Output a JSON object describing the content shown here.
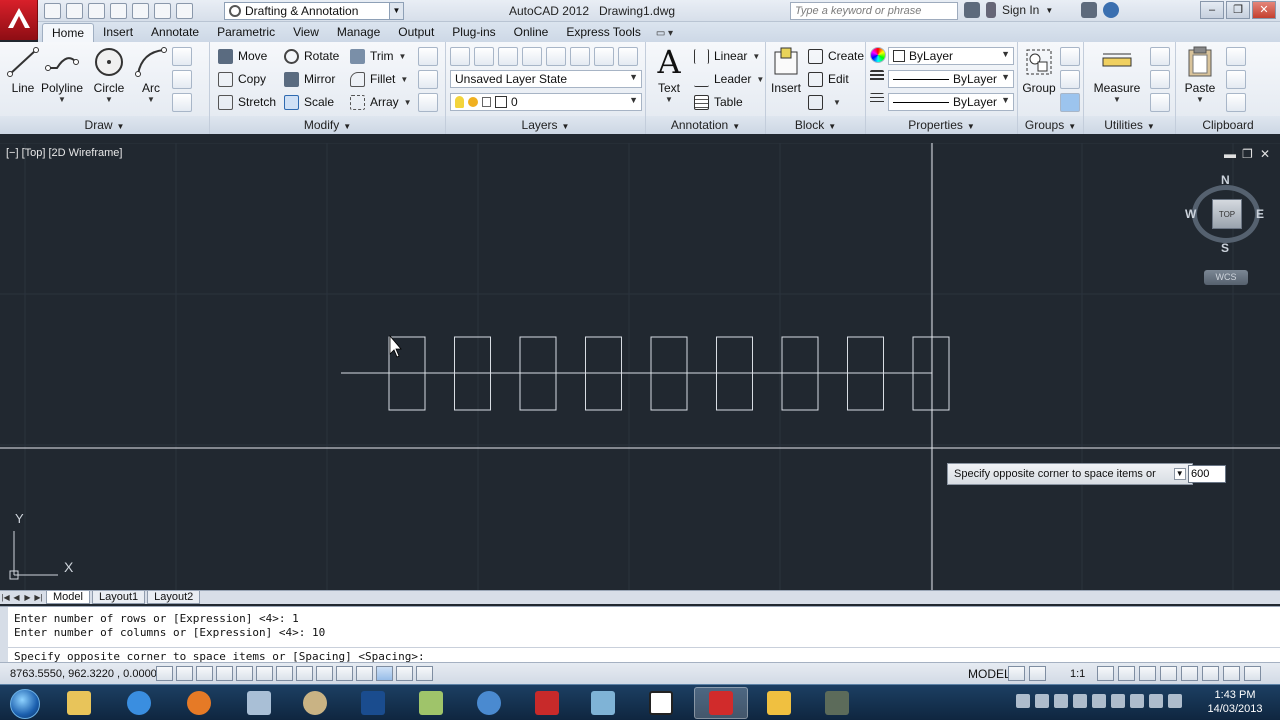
{
  "window": {
    "app_title": "AutoCAD 2012",
    "document": "Drawing1.dwg",
    "workspace": "Drafting & Annotation",
    "search_placeholder": "Type a keyword or phrase",
    "sign_in": "Sign In"
  },
  "tabs": [
    "Home",
    "Insert",
    "Annotate",
    "Parametric",
    "View",
    "Manage",
    "Output",
    "Plug-ins",
    "Online",
    "Express Tools"
  ],
  "active_tab": "Home",
  "ribbon": {
    "draw": {
      "title": "Draw",
      "line": "Line",
      "polyline": "Polyline",
      "circle": "Circle",
      "arc": "Arc"
    },
    "modify": {
      "title": "Modify",
      "move": "Move",
      "rotate": "Rotate",
      "trim": "Trim",
      "copy": "Copy",
      "mirror": "Mirror",
      "fillet": "Fillet",
      "stretch": "Stretch",
      "scale": "Scale",
      "array": "Array"
    },
    "layers": {
      "title": "Layers",
      "layer_state": "Unsaved Layer State",
      "current_layer": "0"
    },
    "annotation": {
      "title": "Annotation",
      "text": "Text",
      "linear": "Linear",
      "leader": "Leader",
      "table": "Table"
    },
    "block": {
      "title": "Block",
      "insert": "Insert",
      "create": "Create",
      "edit": "Edit"
    },
    "properties": {
      "title": "Properties",
      "color": "ByLayer",
      "linetype": "ByLayer",
      "lineweight": "ByLayer"
    },
    "groups": {
      "title": "Groups",
      "group": "Group"
    },
    "utilities": {
      "title": "Utilities",
      "measure": "Measure"
    },
    "clipboard": {
      "title": "Clipboard",
      "paste": "Paste"
    }
  },
  "viewport": {
    "label": "[−] [Top] [2D Wireframe]",
    "viewcube": {
      "n": "N",
      "s": "S",
      "e": "E",
      "w": "W",
      "face": "TOP",
      "ucs": "WCS"
    },
    "ucs_x": "X",
    "ucs_y": "Y"
  },
  "dynamic_input": {
    "prompt": "Specify opposite corner to space items or",
    "value": "600"
  },
  "layout_tabs": [
    "Model",
    "Layout1",
    "Layout2"
  ],
  "command_history": [
    "Enter number of rows or [Expression] <4>: 1",
    "Enter number of columns or [Expression] <4>: 10",
    "Specify opposite corner to space items or [Spacing] <Spacing>:"
  ],
  "status": {
    "coords": "8763.5550, 962.3220 , 0.0000",
    "space": "MODEL",
    "annotation_scale": "1:1"
  },
  "taskbar": {
    "time": "1:43 PM",
    "date": "14/03/2013"
  },
  "colors": {
    "canvas_bg": "#212830",
    "geometry": "#d8dde3",
    "ribbon_bg": "#e8edf4",
    "taskbar_bg": "#17365a"
  }
}
